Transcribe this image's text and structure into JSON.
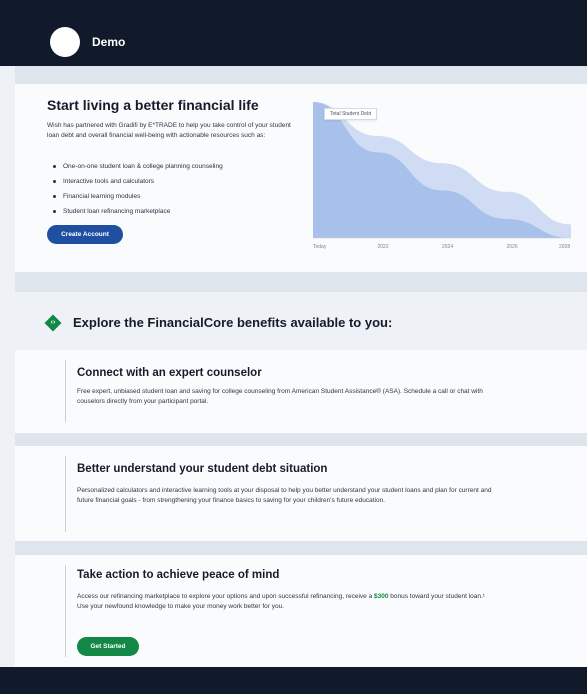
{
  "header": {
    "brand": "Demo"
  },
  "hero": {
    "title": "Start living a better financial life",
    "intro": "Wish has partnered with Gradifi by E*TRADE to help you take control of your student loan debt and overall financial well-being with actionable resources such as:",
    "bullets": [
      "One-on-one student loan & college planning counseling",
      "Interactive tools and calculators",
      "Financial learning modules",
      "Student loan refinancing marketplace"
    ],
    "button_label": "Create Account"
  },
  "chart_data": {
    "type": "area",
    "title": "",
    "xlabel": "",
    "ylabel": "",
    "x": [
      "Today",
      "2022",
      "2024",
      "2026",
      "2028"
    ],
    "series": [
      {
        "name": "Total Student Debt",
        "values": [
          1.0,
          0.63,
          0.35,
          0.14,
          0.0
        ]
      },
      {
        "name": "",
        "values": [
          1.0,
          0.75,
          0.55,
          0.34,
          0.1
        ]
      }
    ],
    "tooltip": "Total Student Debt",
    "ylim": [
      0,
      1
    ],
    "colors": [
      "#a7c1ea",
      "#cfdcf3"
    ],
    "grid": false
  },
  "benefits": {
    "heading": "Explore the FinancialCore benefits available to you:",
    "icon": "diamond-arrows-icon",
    "cards": [
      {
        "title": "Connect with an expert counselor",
        "body": "Free expert, unbiased student loan and saving for college counseling from American Student Assistance® (ASA). Schedule a call or chat with couselors directly from your participant portal."
      },
      {
        "title": "Better understand your student debt situation",
        "body": "Personalized calculators and interactive learning tools at your disposal to help you better understand your student loans and plan for current and future financial goals - from strengthening your finance basics to saving for your children's future education."
      },
      {
        "title": "Take action to achieve peace of mind",
        "body_pre": "Access our refinancing marketplace to explore your options and upon successful refinancing, receive a ",
        "body_amount": "$300",
        "body_post": " bonus toward your student loan.¹ Use your newfound knowledge to make your money work better for you.",
        "button_label": "Get Started"
      }
    ]
  },
  "colors": {
    "navy": "#101a2b",
    "blue_button": "#1f4fa0",
    "green": "#128746"
  }
}
